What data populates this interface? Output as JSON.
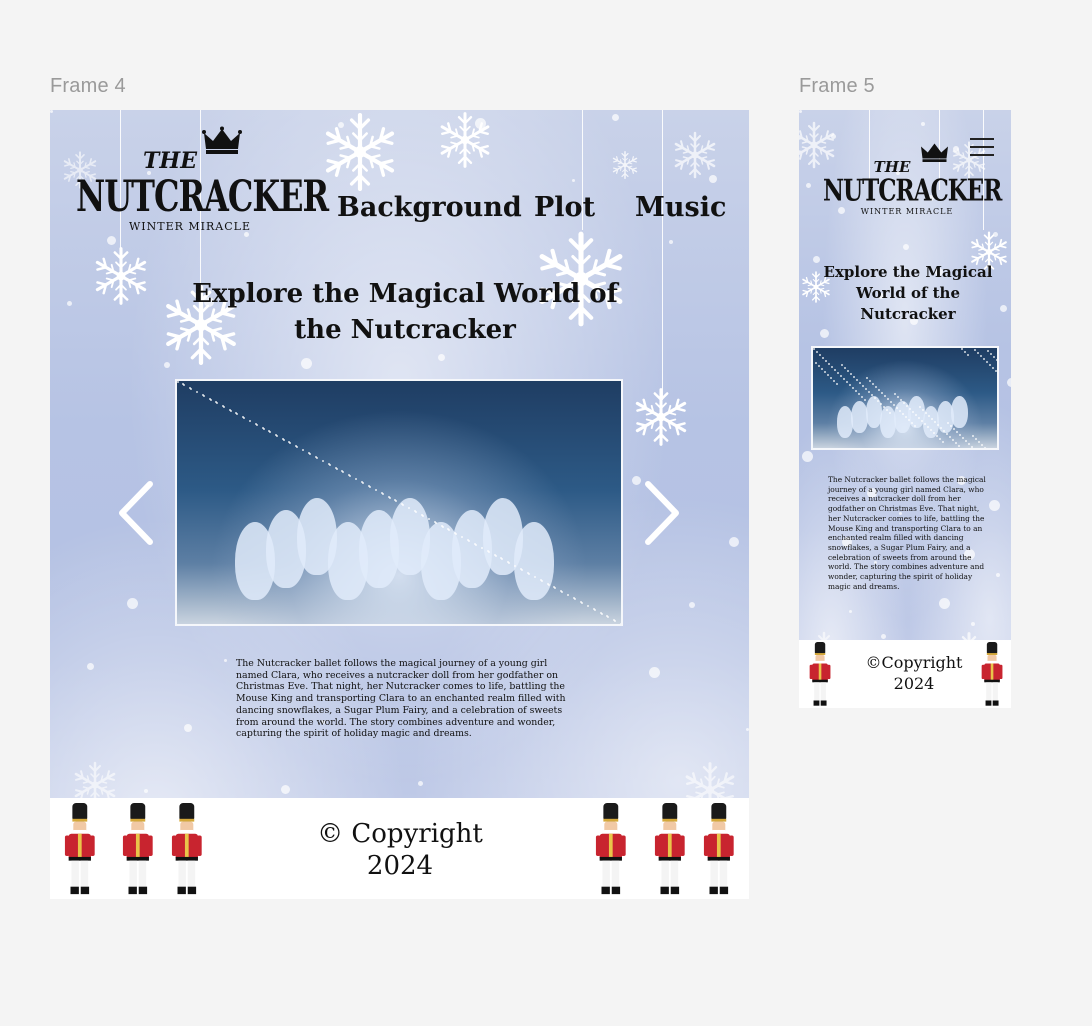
{
  "canvas": {
    "frame4_label": "Frame 4",
    "frame5_label": "Frame 5"
  },
  "logo": {
    "the": "THE",
    "name": "NUTCRACKER",
    "tagline": "WINTER MIRACLE"
  },
  "nav": {
    "background": "Background",
    "plot": "Plot",
    "music": "Music"
  },
  "hero": {
    "headline": "Explore the Magical World of the Nutcracker",
    "image_alt": "Ballet dancers in white tutus in a snowy scene"
  },
  "body": {
    "desktop_paragraph": "The Nutcracker ballet follows the magical journey of a young girl named Clara, who receives a nutcracker doll from her godfather on Christmas Eve. That night, her Nutcracker comes to life, battling the Mouse King and transporting Clara to an enchanted realm filled with dancing snowflakes, a Sugar Plum Fairy, and a celebration of sweets from around the world. The story combines adventure and wonder, capturing the spirit of holiday magic and dreams.",
    "mobile_paragraph": "The Nutcracker ballet follows the magical journey of a young girl named Clara, who receives a nutcracker doll from her godfather on Christmas Eve. That night, her Nutcracker comes to life, battling the Mouse King and transporting Clara to an enchanted realm filled with dancing snowflakes, a Sugar Plum Fairy, and a celebration of sweets from around the world. The story combines adventure and wonder, capturing the spirit of holiday magic and dreams."
  },
  "footer": {
    "desktop_copyright": "© Copyright\n2024",
    "mobile_copyright": "©Copyright\n2024"
  },
  "icons": {
    "prev": "chevron-left-icon",
    "next": "chevron-right-icon",
    "menu": "hamburger-menu-icon",
    "soldier": "nutcracker-soldier-icon"
  },
  "colors": {
    "sky": "#b6c3e4",
    "text": "#111111",
    "soldier_coat": "#c8242f",
    "soldier_hat": "#1a1a1a"
  }
}
